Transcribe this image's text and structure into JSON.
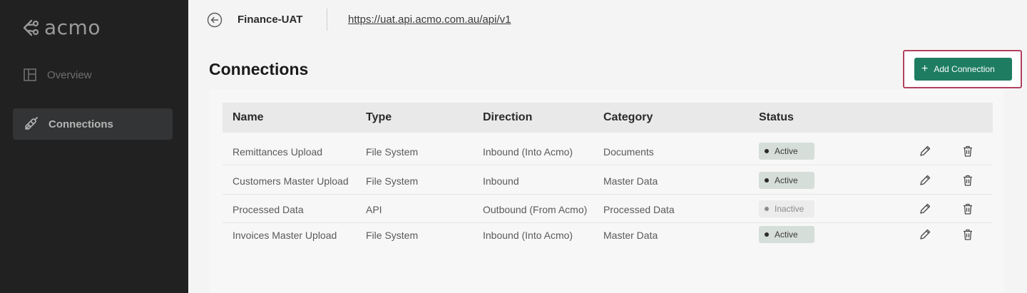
{
  "brand": {
    "logo_text": "acmo"
  },
  "sidebar": {
    "items": [
      {
        "label": "Overview",
        "icon": "layout-icon",
        "active": false
      },
      {
        "label": "Connections",
        "icon": "plug-icon",
        "active": true
      }
    ]
  },
  "topbar": {
    "environment": "Finance-UAT",
    "url": "https://uat.api.acmo.com.au/api/v1"
  },
  "page": {
    "title": "Connections",
    "add_button_label": "Add Connection"
  },
  "table": {
    "columns": [
      "Name",
      "Type",
      "Direction",
      "Category",
      "Status"
    ],
    "rows": [
      {
        "name": "Remittances Upload",
        "type": "File System",
        "direction": "Inbound (Into Acmo)",
        "category": "Documents",
        "status": "Active"
      },
      {
        "name": "Customers Master Upload",
        "type": "File System",
        "direction": "Inbound",
        "category": "Master Data",
        "status": "Active"
      },
      {
        "name": "Processed Data",
        "type": "API",
        "direction": "Outbound (From Acmo)",
        "category": "Processed Data",
        "status": "Inactive"
      },
      {
        "name": "Invoices Master Upload",
        "type": "File System",
        "direction": "Inbound (Into Acmo)",
        "category": "Master Data",
        "status": "Active"
      }
    ]
  },
  "colors": {
    "sidebar_bg": "#212121",
    "primary_button": "#1e7d61",
    "highlight_border": "#b0405d",
    "active_badge": "#d6ded9"
  }
}
